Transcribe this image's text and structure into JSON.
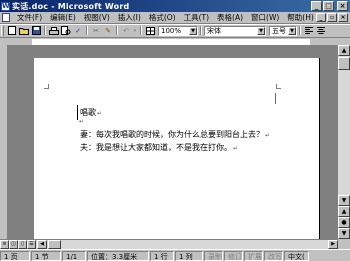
{
  "window": {
    "title": "实话.doc - Microsoft Word"
  },
  "menu": {
    "items": [
      "文件(F)",
      "编辑(E)",
      "视图(V)",
      "插入(I)",
      "格式(O)",
      "工具(T)",
      "表格(A)",
      "窗口(W)",
      "帮助(H)"
    ]
  },
  "toolbar": {
    "zoom": "100%",
    "font_name": "宋体",
    "font_size": "五号"
  },
  "document": {
    "title_line": "唱歌",
    "line1": "妻：每次我唱歌的时候，你为什么总要到阳台上去？",
    "line2": "夫：我是想让大家都知道，不是我在打你。",
    "para_mark": "↵"
  },
  "status": {
    "page": "1 页",
    "section": "1 节",
    "page_of": "1/1",
    "position": "位置：3.3厘米",
    "line": "1 行",
    "column": "1 列",
    "rec": "录制",
    "trk": "修订",
    "ext": "扩展",
    "ovr": "改写",
    "lang": "中文("
  }
}
